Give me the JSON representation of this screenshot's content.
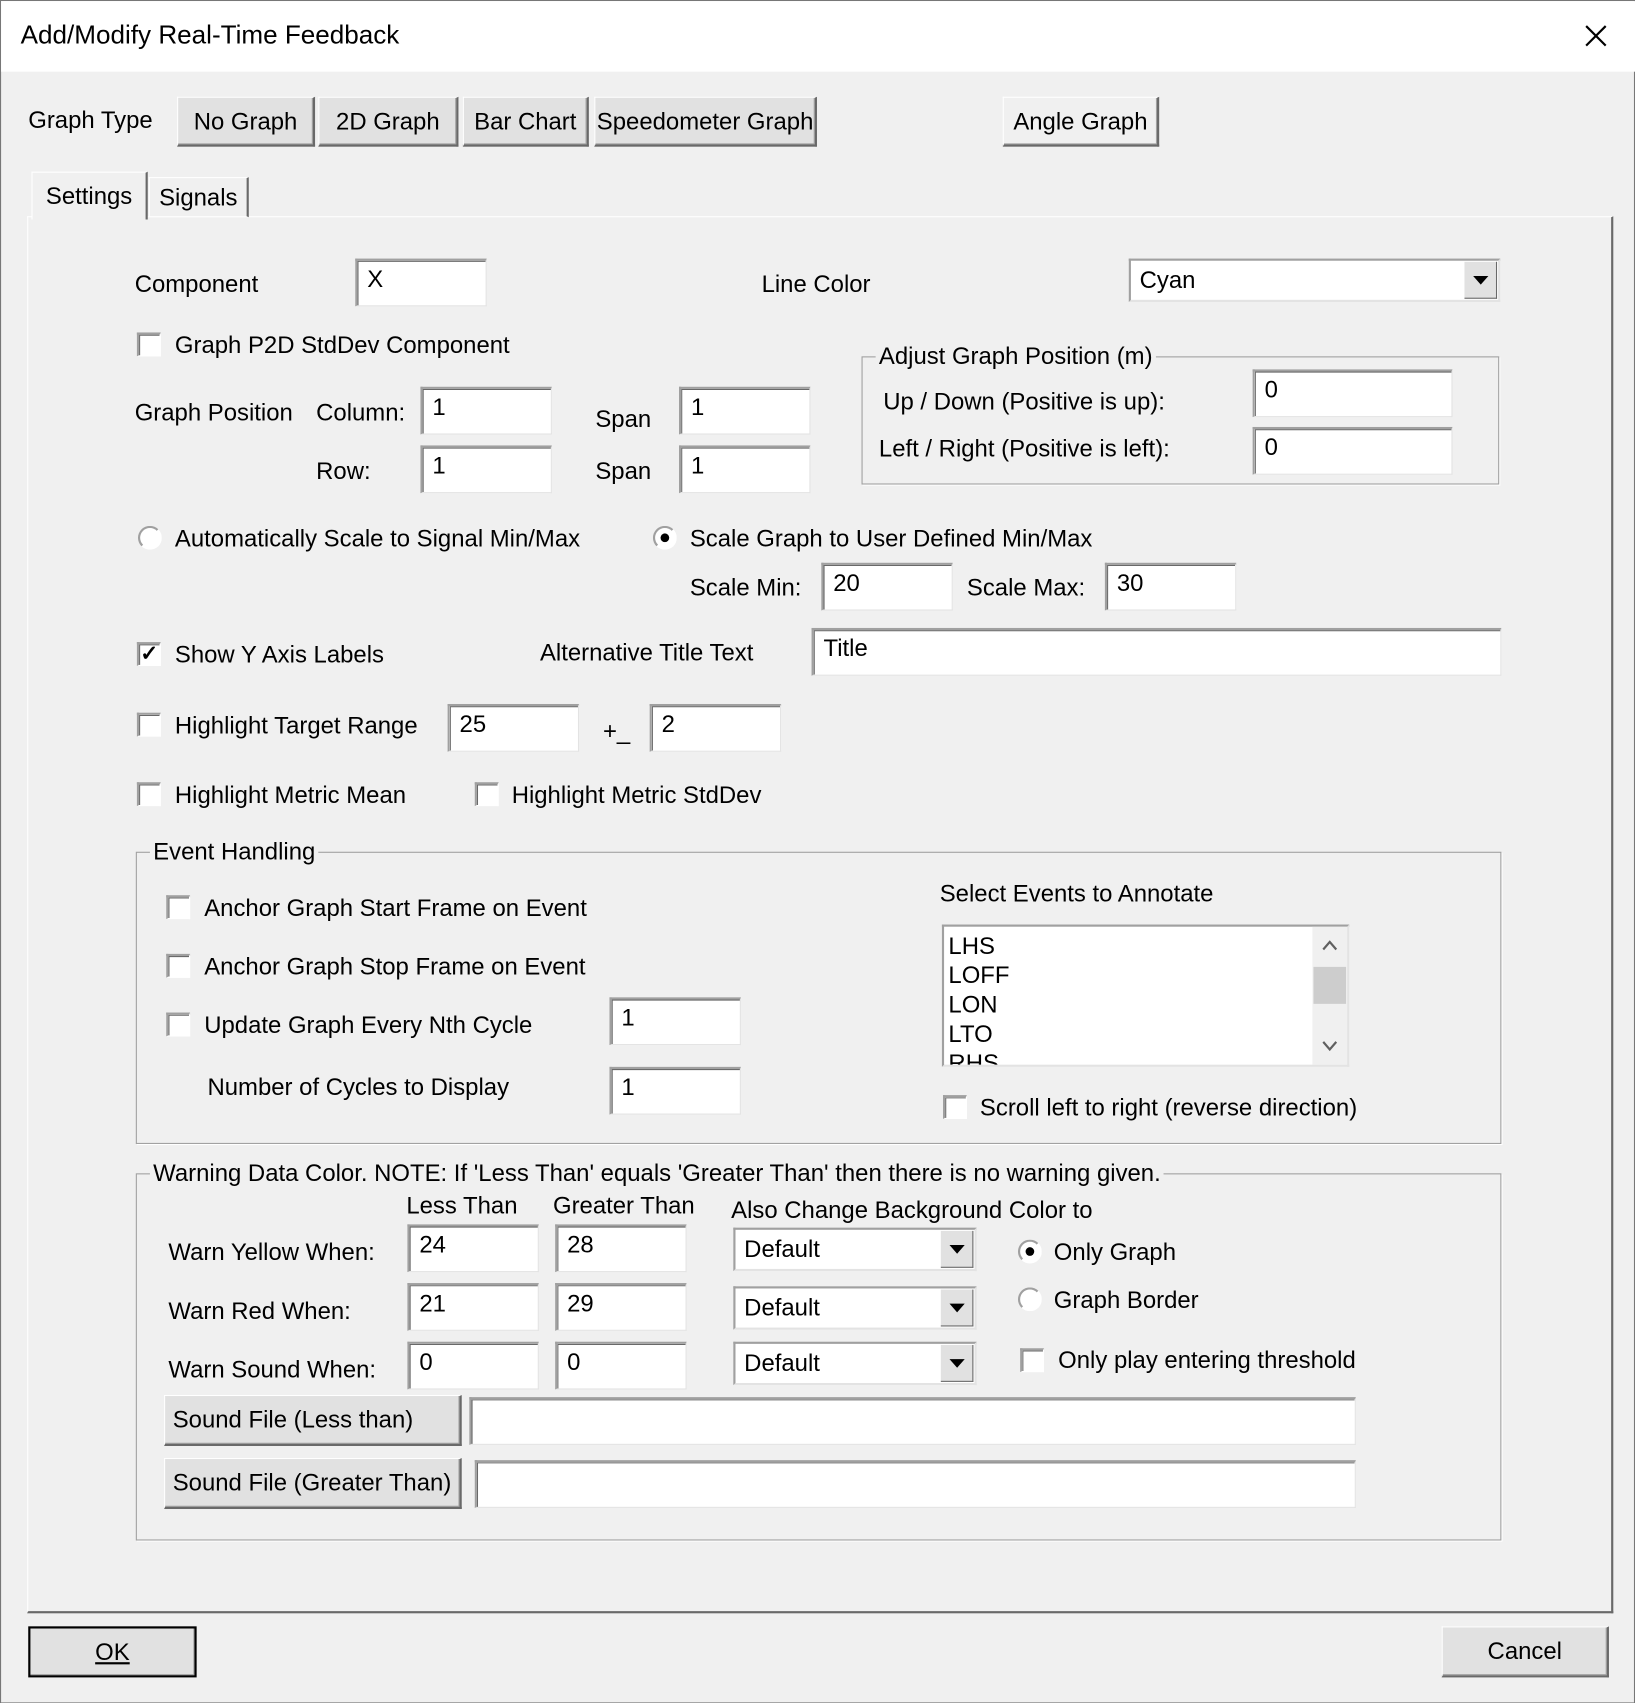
{
  "window": {
    "title": "Add/Modify Real-Time Feedback",
    "close_icon": "close-icon"
  },
  "graph_type": {
    "label": "Graph Type",
    "buttons": [
      "No Graph",
      "2D Graph",
      "Bar Chart",
      "Speedometer Graph",
      "Angle Graph"
    ],
    "selected": "Angle Graph"
  },
  "tabs": [
    {
      "label": "Settings",
      "active": true
    },
    {
      "label": "Signals",
      "active": false
    }
  ],
  "settings": {
    "component_label": "Component",
    "component_value": "X",
    "line_color_label": "Line Color",
    "line_color_value": "Cyan",
    "p2d_label": "Graph P2D StdDev Component",
    "p2d_checked": false,
    "graph_position_label": "Graph Position",
    "column_label": "Column:",
    "column_value": "1",
    "row_label": "Row:",
    "row_value": "1",
    "span_label": "Span",
    "span_col_value": "1",
    "span_row_value": "1",
    "adjust_group": "Adjust Graph Position (m)",
    "updown_label": "Up / Down (Positive is up):",
    "updown_value": "0",
    "leftright_label": "Left / Right (Positive is left):",
    "leftright_value": "0",
    "auto_scale_label": "Automatically Scale to Signal Min/Max",
    "user_scale_label": "Scale Graph to User Defined Min/Max",
    "scale_mode": "user",
    "scale_min_label": "Scale Min:",
    "scale_min": "20",
    "scale_max_label": "Scale Max:",
    "scale_max": "30",
    "show_y_label": "Show Y Axis Labels",
    "show_y_checked": true,
    "alt_title_label": "Alternative Title Text",
    "alt_title_value": "Title",
    "target_range_label": "Highlight Target Range",
    "target_value": "25",
    "plusminus": "+_",
    "target_tol": "2",
    "metric_mean_label": "Highlight Metric Mean",
    "metric_std_label": "Highlight Metric StdDev"
  },
  "events": {
    "group": "Event Handling",
    "anchor_start": "Anchor Graph Start Frame on Event",
    "anchor_stop": "Anchor Graph Stop Frame on Event",
    "update_nth": "Update Graph Every Nth Cycle",
    "update_nth_value": "1",
    "cycles_label": "Number of Cycles to Display",
    "cycles_value": "1",
    "select_label": "Select Events to Annotate",
    "items": [
      "LHS",
      "LOFF",
      "LON",
      "LTO",
      "RHS"
    ],
    "scroll_reverse": "Scroll left to right (reverse direction)"
  },
  "warning": {
    "group": "Warning Data Color. NOTE: If 'Less Than' equals 'Greater Than' then there is no warning given.",
    "less_than": "Less Than",
    "greater_than": "Greater Than",
    "also_change": "Also Change Background Color to",
    "rows": [
      {
        "label": "Warn Yellow When:",
        "less": "24",
        "greater": "28",
        "color": "Default"
      },
      {
        "label": "Warn Red When:",
        "less": "21",
        "greater": "29",
        "color": "Default"
      },
      {
        "label": "Warn Sound When:",
        "less": "0",
        "greater": "0",
        "color": "Default"
      }
    ],
    "only_graph": "Only Graph",
    "graph_border": "Graph Border",
    "bg_mode": "only_graph",
    "only_entering": "Only play entering threshold",
    "sound_less_btn": "Sound File (Less than)",
    "sound_less_value": "",
    "sound_greater_btn": "Sound File (Greater Than)",
    "sound_greater_value": ""
  },
  "footer": {
    "ok": "OK",
    "cancel": "Cancel"
  }
}
